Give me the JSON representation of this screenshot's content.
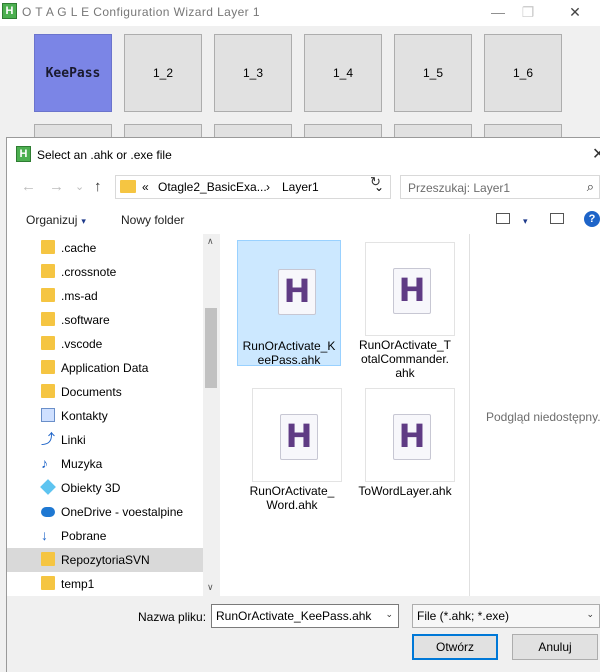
{
  "wizard": {
    "title": "O T A G L E Configuration Wizard Layer 1",
    "app_icon": "H",
    "minimize": "—",
    "restore": "❐",
    "close": "✕",
    "buttons": [
      "KeePass",
      "1_2",
      "1_3",
      "1_4",
      "1_5",
      "1_6"
    ]
  },
  "dialog": {
    "title": "Select an .ahk or .exe file",
    "icon": "H",
    "close": "✕",
    "nav": {
      "back": "←",
      "forward": "→",
      "recent": "⌄",
      "up": "↑"
    },
    "address": {
      "prefix": "«",
      "segment1": "Otagle2_BasicExa...",
      "sep": "›",
      "segment2": "Layer1",
      "chevron": "⌄",
      "refresh": "↻"
    },
    "search_placeholder": "Przeszukaj: Layer1",
    "search_icon": "⌕",
    "toolbar": {
      "organize": "Organizuj",
      "new_folder": "Nowy folder",
      "caret": "▾",
      "help": "?"
    },
    "nav_items": [
      {
        "label": ".cache",
        "icon": "folder-icon"
      },
      {
        "label": ".crossnote",
        "icon": "folder-icon"
      },
      {
        "label": ".ms-ad",
        "icon": "folder-icon"
      },
      {
        "label": ".software",
        "icon": "folder-icon"
      },
      {
        "label": ".vscode",
        "icon": "folder-icon"
      },
      {
        "label": "Application Data",
        "icon": "folder-icon"
      },
      {
        "label": "Documents",
        "icon": "folder-icon"
      },
      {
        "label": "Kontakty",
        "icon": "contacts-icon"
      },
      {
        "label": "Linki",
        "icon": "links-icon"
      },
      {
        "label": "Muzyka",
        "icon": "music-icon"
      },
      {
        "label": "Obiekty 3D",
        "icon": "objects-3d-icon"
      },
      {
        "label": "OneDrive - voestalpine",
        "icon": "cloud-icon"
      },
      {
        "label": "Pobrane",
        "icon": "download-icon"
      },
      {
        "label": "RepozytoriaSVN",
        "icon": "folder-icon"
      },
      {
        "label": "temp1",
        "icon": "folder-icon"
      }
    ],
    "files": [
      {
        "name": "RunOrActivate_K\neePass.ahk",
        "glyph": "H",
        "selected": true
      },
      {
        "name": "RunOrActivate_T\notalCommander.\nahk",
        "glyph": "H",
        "selected": false
      },
      {
        "name": "RunOrActivate_\nWord.ahk",
        "glyph": "H",
        "selected": false
      },
      {
        "name": "ToWordLayer.ahk",
        "glyph": "H",
        "selected": false
      }
    ],
    "preview_message": "Podgląd niedostępny.",
    "filename_label": "Nazwa pliku:",
    "filename_value": "RunOrActivate_KeePass.ahk",
    "filetype_value": "File (*.ahk; *.exe)",
    "open_button": "Otwórz",
    "cancel_button": "Anuluj",
    "dropdown_caret": "⌄",
    "scroll_up": "∧",
    "scroll_down": "∨"
  }
}
